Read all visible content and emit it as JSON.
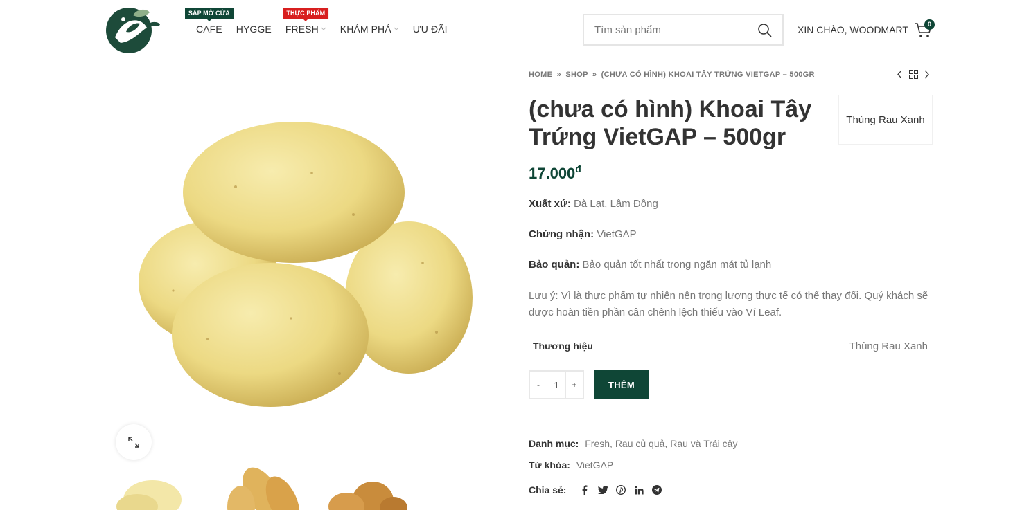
{
  "header": {
    "logo_icon": "leaf-logo",
    "nav": [
      {
        "label": "CAFE",
        "badge": "SẮP MỞ CỬA",
        "badge_color": "#0f4636",
        "dropdown": false
      },
      {
        "label": "HYGGE",
        "badge": "",
        "dropdown": false
      },
      {
        "label": "FRESH",
        "badge": "THỰC PHẨM",
        "badge_color": "#d81f1f",
        "dropdown": true
      },
      {
        "label": "KHÁM PHÁ",
        "badge": "",
        "dropdown": true
      },
      {
        "label": "ƯU ĐÃI",
        "badge": "",
        "dropdown": false
      }
    ],
    "search": {
      "placeholder": "Tìm sản phẩm"
    },
    "greeting": "XIN CHÀO, WOODMART",
    "cart": {
      "count": "0"
    }
  },
  "breadcrumb": {
    "home": "HOME",
    "shop": "SHOP",
    "current": "(CHƯA CÓ HÌNH) KHOAI TÂY TRỨNG VIETGAP – 500GR",
    "separator": "»"
  },
  "product": {
    "title": "(chưa có hình) Khoai Tây Trứng VietGAP – 500gr",
    "brand_box": "Thùng Rau Xanh",
    "price": "17.000",
    "currency": "đ",
    "attributes": [
      {
        "label": "Xuất xứ:",
        "value": "Đà Lạt, Lâm Đồng"
      },
      {
        "label": "Chứng nhận:",
        "value": "VietGAP"
      },
      {
        "label": "Bảo quản:",
        "value": "Bảo quản tốt nhất trong ngăn mát tủ lạnh"
      }
    ],
    "note": "Lưu ý: Vì là thực phẩm tự nhiên nên trọng lượng thực tế có thể thay đổi. Quý khách sẽ được hoàn tiền phần cân chênh lệch thiếu vào Ví Leaf.",
    "brand_row": {
      "label": "Thương hiệu",
      "value": "Thùng Rau Xanh"
    },
    "quantity": {
      "minus": "-",
      "value": "1",
      "plus": "+"
    },
    "add_button": "THÊM",
    "categories_label": "Danh mục:",
    "categories": [
      "Fresh",
      "Rau củ quả",
      "Rau và Trái cây"
    ],
    "tags_label": "Từ khóa:",
    "tags": [
      "VietGAP"
    ],
    "share_label": "Chia sẻ:",
    "share_icons": [
      "facebook-icon",
      "twitter-icon",
      "pinterest-icon",
      "linkedin-icon",
      "telegram-icon"
    ]
  },
  "colors": {
    "brand": "#0f4636",
    "badge_red": "#d81f1f",
    "text": "#333333",
    "muted": "#777777"
  }
}
